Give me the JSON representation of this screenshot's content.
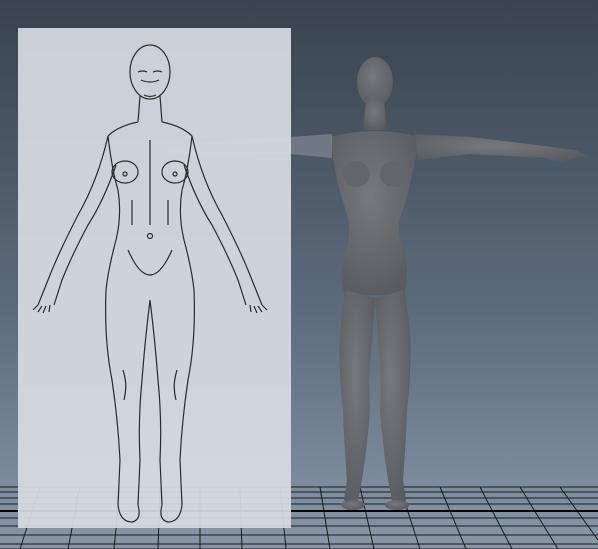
{
  "viewport": {
    "background_top": "#3a4450",
    "background_mid": "#5f6f80",
    "background_bottom": "#8a9aaa",
    "grid_color": "#1c1c1c",
    "grid_major_color": "#0a0a0a"
  },
  "image_plane": {
    "fill": "#d6dbe2",
    "opacity": 0.9,
    "line_color": "#2b2b2b"
  },
  "mesh": {
    "fill": "#6b6f74",
    "shade": "#585c61",
    "pose": "T-pose"
  }
}
